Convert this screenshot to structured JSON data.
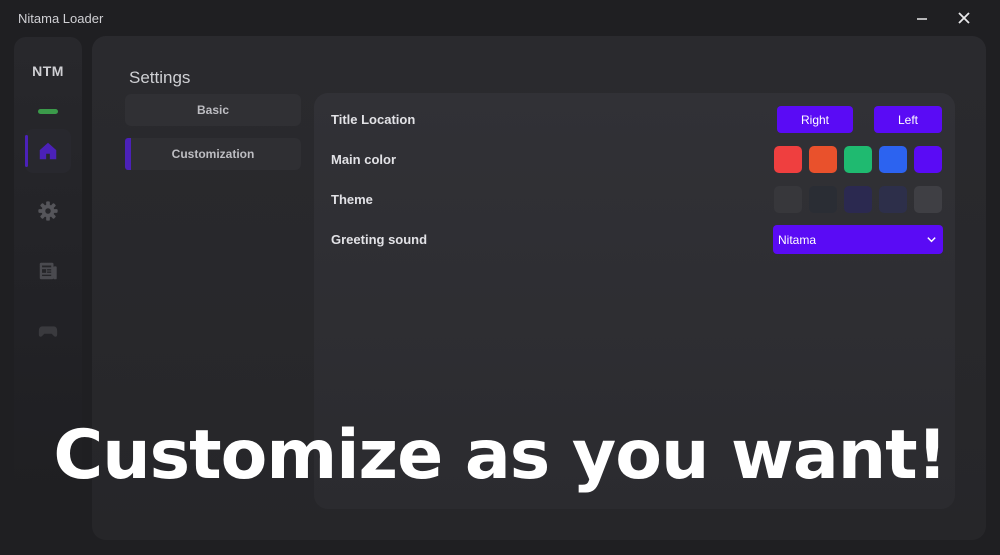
{
  "window": {
    "title": "Nitama Loader"
  },
  "sidebar": {
    "logo": "NTM",
    "status_color": "#3b9a4a",
    "items": [
      {
        "icon": "home-icon",
        "active": true
      },
      {
        "icon": "gear-icon",
        "active": false
      },
      {
        "icon": "news-icon",
        "active": false
      },
      {
        "icon": "gamepad-icon",
        "active": false
      }
    ]
  },
  "settings": {
    "title": "Settings",
    "tabs": [
      {
        "label": "Basic"
      },
      {
        "label": "Customization",
        "active": true
      }
    ]
  },
  "customization": {
    "title_location": {
      "label": "Title Location",
      "options": [
        {
          "label": "Right"
        },
        {
          "label": "Left"
        }
      ]
    },
    "main_color": {
      "label": "Main color",
      "swatches": [
        "#ef3f3f",
        "#e9512c",
        "#1fba70",
        "#2c63f0",
        "#5a0bf5"
      ]
    },
    "theme": {
      "label": "Theme",
      "swatches": [
        "#37373b",
        "#2a2d34",
        "#2b2950",
        "#2d2f4a",
        "#3f3f44"
      ]
    },
    "greeting_sound": {
      "label": "Greeting sound",
      "value": "Nitama"
    }
  },
  "banner": {
    "text": "Customize as you want!"
  },
  "colors": {
    "accent": "#5a0bf5",
    "accent_bar": "#4b21b8"
  }
}
